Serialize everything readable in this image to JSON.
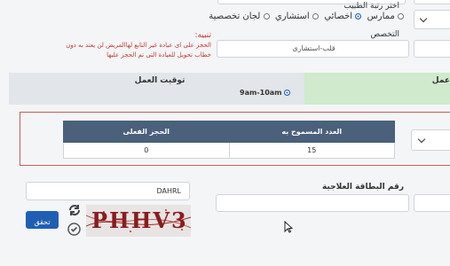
{
  "doctor_rank": {
    "label": "اختر رتبة الطبيب",
    "options": [
      {
        "label": "ممارس",
        "selected": false
      },
      {
        "label": "اخصائي",
        "selected": true
      },
      {
        "label": "استشاري",
        "selected": false
      },
      {
        "label": "لجان تخصصية",
        "selected": false
      }
    ]
  },
  "note": {
    "title": "تنبيه:",
    "line1": "الحجز على اى عيادة غير التابع لهاالمريض لن يعتد به دون",
    "line2": "خطاب تحويل للعيادة التى تم الحجز عليها"
  },
  "specialty": {
    "label": "التخصص",
    "value": "قلب-استشارى"
  },
  "work_band": {
    "header": "توقيت العمل",
    "green_label": "عمل",
    "slot_label": "9am-10am"
  },
  "booking_table": {
    "headers": [
      "الحجز الفعلى",
      "العدد المسموح به"
    ],
    "row": [
      "0",
      "15"
    ]
  },
  "captcha": {
    "input_value": "DAHRL",
    "image_text": "PHHV3",
    "verify_label": "تحقق"
  },
  "national_id": {
    "label": "رقم البطاقة العلاجية"
  },
  "colors": {
    "table_header": "#4a607b",
    "green_band": "#cfeacd",
    "blue_button": "#1f5fb3",
    "note_red": "#c0392b"
  }
}
